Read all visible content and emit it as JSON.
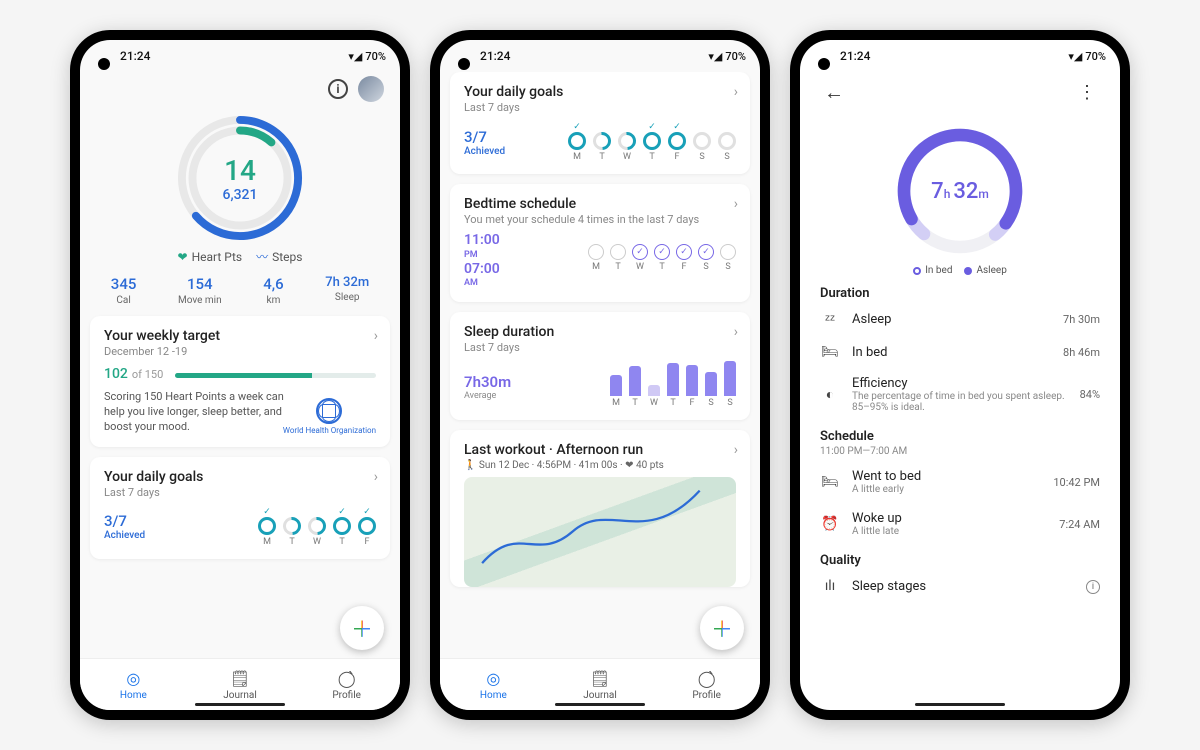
{
  "statusbar": {
    "time": "21:24",
    "battery": "70%"
  },
  "colors": {
    "teal": "#23a786",
    "blue": "#2c6bd6",
    "cyan": "#18a0b8",
    "purple": "#6a5de0",
    "lilac": "#8f86f0"
  },
  "screen1": {
    "ring": {
      "heart_pts": "14",
      "steps": "6,321"
    },
    "legend": {
      "heart": "Heart Pts",
      "steps": "Steps"
    },
    "stats": [
      {
        "value": "345",
        "unit": "",
        "label": "Cal"
      },
      {
        "value": "154",
        "unit": "",
        "label": "Move min"
      },
      {
        "value": "4,6",
        "unit": "",
        "label": "km"
      },
      {
        "value": "7h 32m",
        "unit": "",
        "label": "Sleep"
      }
    ],
    "weekly": {
      "title": "Your weekly target",
      "dates": "December 12 -19",
      "score": "102",
      "of_label": "of 150",
      "pct": 68,
      "desc": "Scoring 150 Heart Points a week can help you live longer, sleep better, and boost your mood.",
      "who": "World Health Organization"
    },
    "daily": {
      "title": "Your daily goals",
      "sub": "Last 7 days",
      "score": "3/7",
      "score_label": "Achieved",
      "days": [
        {
          "l": "M",
          "state": "full",
          "check": true
        },
        {
          "l": "T",
          "state": "half",
          "check": false
        },
        {
          "l": "W",
          "state": "half",
          "check": false
        },
        {
          "l": "T",
          "state": "full",
          "check": true
        },
        {
          "l": "F",
          "state": "full",
          "check": true
        }
      ]
    },
    "nav": {
      "home": "Home",
      "journal": "Journal",
      "profile": "Profile"
    }
  },
  "screen2": {
    "daily": {
      "title": "Your daily goals",
      "sub": "Last 7 days",
      "score": "3/7",
      "score_label": "Achieved",
      "days": [
        {
          "l": "M",
          "state": "full",
          "check": true
        },
        {
          "l": "T",
          "state": "half",
          "check": false
        },
        {
          "l": "W",
          "state": "half",
          "check": false
        },
        {
          "l": "T",
          "state": "full",
          "check": true
        },
        {
          "l": "F",
          "state": "full",
          "check": true
        },
        {
          "l": "S",
          "state": "none",
          "check": false
        },
        {
          "l": "S",
          "state": "none",
          "check": false
        }
      ]
    },
    "bedtime": {
      "title": "Bedtime schedule",
      "sub": "You met your schedule 4 times in the last 7 days",
      "from": "11:00",
      "from_ampm": "PM",
      "to": "07:00",
      "to_ampm": "AM",
      "days": [
        {
          "l": "M",
          "on": false
        },
        {
          "l": "T",
          "on": false
        },
        {
          "l": "W",
          "on": true
        },
        {
          "l": "T",
          "on": true
        },
        {
          "l": "F",
          "on": true
        },
        {
          "l": "S",
          "on": true
        },
        {
          "l": "S",
          "on": false
        }
      ]
    },
    "sleepdur": {
      "title": "Sleep duration",
      "sub": "Last 7 days",
      "avg": "7h30m",
      "avg_label": "Average",
      "bars": [
        58,
        82,
        30,
        90,
        85,
        64,
        95
      ],
      "days": [
        "M",
        "T",
        "W",
        "T",
        "F",
        "S",
        "S"
      ]
    },
    "workout": {
      "title": "Last workout · Afternoon run",
      "meta": "🚶 Sun 12 Dec · 4:56PM · 41m 00s · ❤ 40 pts"
    }
  },
  "screen3": {
    "ring": {
      "value_h": "7",
      "value_m": "32"
    },
    "legend": {
      "inbed": "In bed",
      "asleep": "Asleep"
    },
    "sections": {
      "duration": {
        "title": "Duration",
        "rows": [
          {
            "icon": "zzz",
            "t1": "Asleep",
            "t2": "",
            "val": "7h 30m"
          },
          {
            "icon": "bed",
            "t1": "In bed",
            "t2": "",
            "val": "8h 46m"
          },
          {
            "icon": "eff",
            "t1": "Efficiency",
            "t2": "The percentage of time in bed you spent asleep. 85–95% is ideal.",
            "val": "84%"
          }
        ]
      },
      "schedule": {
        "title": "Schedule",
        "sub": "11:00 PM—7:00 AM",
        "rows": [
          {
            "icon": "gobed",
            "t1": "Went to bed",
            "t2": "A little early",
            "val": "10:42 PM"
          },
          {
            "icon": "alarm",
            "t1": "Woke up",
            "t2": "A little late",
            "val": "7:24 AM"
          }
        ]
      },
      "quality": {
        "title": "Quality",
        "rows": [
          {
            "icon": "stages",
            "t1": "Sleep stages",
            "t2": "",
            "val": ""
          }
        ]
      }
    }
  }
}
